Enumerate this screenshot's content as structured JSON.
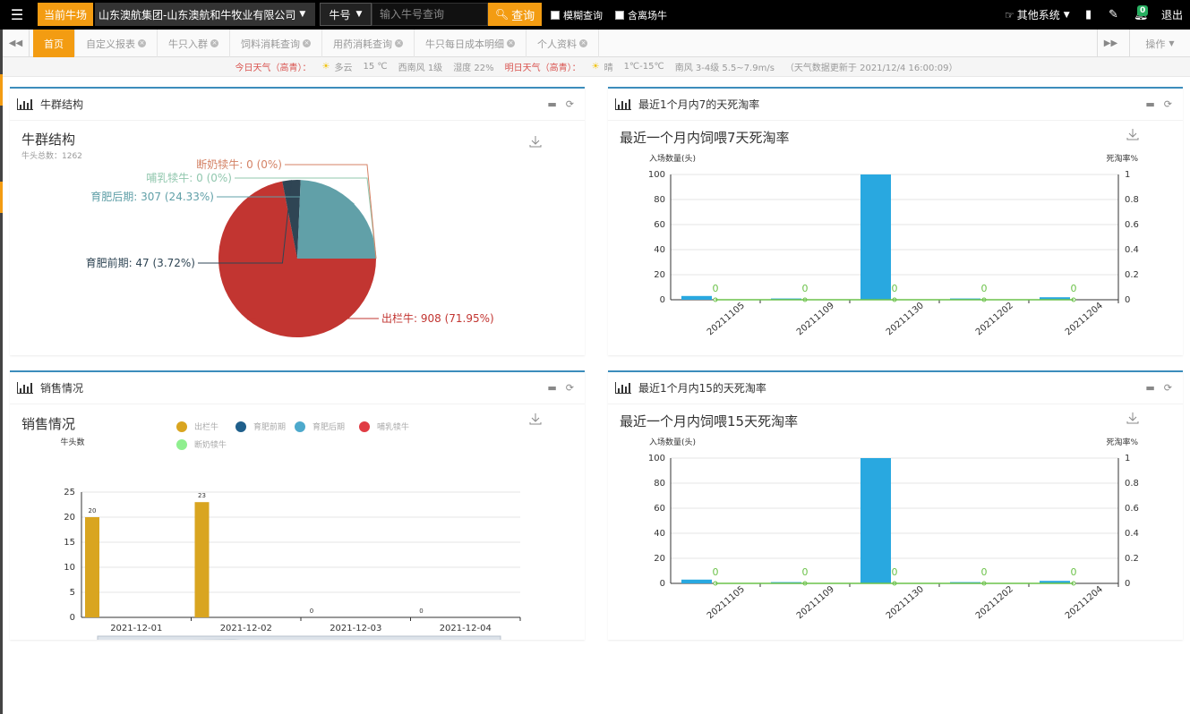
{
  "topbar": {
    "current_farm_label": "当前牛场",
    "farm_name": "山东澳航集团-山东澳航和牛牧业有限公司",
    "cattle_type": "牛号",
    "search_placeholder": "输入牛号查询",
    "query_label": "查询",
    "fuzzy_label": "模糊查询",
    "include_left_label": "含离场牛",
    "other_systems_label": "其他系统",
    "notification_count": "0",
    "logout_label": "退出"
  },
  "tabs": [
    {
      "label": "首页",
      "active": true,
      "closable": false
    },
    {
      "label": "自定义报表",
      "active": false,
      "closable": true
    },
    {
      "label": "牛只入群",
      "active": false,
      "closable": true
    },
    {
      "label": "饲料消耗查询",
      "active": false,
      "closable": true
    },
    {
      "label": "用药消耗查询",
      "active": false,
      "closable": true
    },
    {
      "label": "牛只每日成本明细",
      "active": false,
      "closable": true
    },
    {
      "label": "个人资料",
      "active": false,
      "closable": true
    }
  ],
  "tab_ops_label": "操作",
  "weather": {
    "today_label": "今日天气（高青）：",
    "today_cond": "多云",
    "today_temp": "15 ℃",
    "today_wind": "西南风 1级",
    "today_humidity": "湿度 22%",
    "tomorrow_label": "明日天气（高青）：",
    "tomorrow_cond": "晴",
    "tomorrow_temp": "1℃-15℃",
    "tomorrow_wind": "南风 3-4级 5.5~7.9m/s",
    "updated": "（天气数据更新于 2021/12/4 16:00:09）"
  },
  "panels": {
    "p1": {
      "title": "牛群结构"
    },
    "p2": {
      "title": "最近1个月内7的天死淘率"
    },
    "p3": {
      "title": "销售情况"
    },
    "p4": {
      "title": "最近1个月内15的天死淘率"
    }
  },
  "chart_data": [
    {
      "type": "pie",
      "title": "牛群结构",
      "subtitle": "牛头总数：1262",
      "slices": [
        {
          "name": "出栏牛",
          "value": 908,
          "pct": "71.95%",
          "color": "#c23531"
        },
        {
          "name": "育肥前期",
          "value": 47,
          "pct": "3.72%",
          "color": "#2f4554"
        },
        {
          "name": "育肥后期",
          "value": 307,
          "pct": "24.33%",
          "color": "#61a0a8"
        },
        {
          "name": "哺乳犊牛",
          "value": 0,
          "pct": "0%",
          "color": "#91c7ae"
        },
        {
          "name": "断奶犊牛",
          "value": 0,
          "pct": "0%",
          "color": "#d48265"
        }
      ]
    },
    {
      "type": "bar",
      "title": "最近一个月内饲喂7天死淘率",
      "ylabel": "入场数量(头)",
      "y2label": "死淘率%",
      "categories": [
        "20211105",
        "20211109",
        "20211130",
        "20211202",
        "20211204"
      ],
      "bar_values": [
        3,
        1,
        100,
        1,
        2
      ],
      "line_values": [
        0,
        0,
        0,
        0,
        0
      ],
      "ylim": [
        0,
        100
      ],
      "y2lim": [
        0,
        1
      ],
      "yticks": [
        0,
        20,
        40,
        60,
        80,
        100
      ],
      "y2ticks": [
        0,
        0.2,
        0.4,
        0.6,
        0.8,
        1
      ]
    },
    {
      "type": "bar",
      "title": "销售情况",
      "ylabel": "牛头数",
      "categories": [
        "2021-12-01",
        "2021-12-02",
        "2021-12-03",
        "2021-12-04"
      ],
      "series": [
        {
          "name": "出栏牛",
          "values": [
            20,
            23,
            0,
            0
          ],
          "color": "#d9a520"
        },
        {
          "name": "育肥前期",
          "values": [
            0,
            0,
            0,
            0
          ],
          "color": "#1f5f8b"
        },
        {
          "name": "育肥后期",
          "values": [
            0,
            0,
            0,
            0
          ],
          "color": "#4da9cc"
        },
        {
          "name": "哺乳犊牛",
          "values": [
            0,
            0,
            0,
            0
          ],
          "color": "#e03c44"
        },
        {
          "name": "断奶犊牛",
          "values": [
            0,
            0,
            0,
            0
          ],
          "color": "#8fef8f"
        }
      ],
      "data_labels": [
        "20",
        "23",
        "0",
        "0"
      ],
      "ylim": [
        0,
        25
      ],
      "yticks": [
        0,
        5,
        10,
        15,
        20,
        25
      ]
    },
    {
      "type": "bar",
      "title": "最近一个月内饲喂15天死淘率",
      "ylabel": "入场数量(头)",
      "y2label": "死淘率%",
      "categories": [
        "20211105",
        "20211109",
        "20211130",
        "20211202",
        "20211204"
      ],
      "bar_values": [
        3,
        1,
        100,
        1,
        2
      ],
      "line_values": [
        0,
        0,
        0,
        0,
        0
      ],
      "ylim": [
        0,
        100
      ],
      "y2lim": [
        0,
        1
      ],
      "yticks": [
        0,
        20,
        40,
        60,
        80,
        100
      ],
      "y2ticks": [
        0,
        0.2,
        0.4,
        0.6,
        0.8,
        1
      ]
    }
  ],
  "colors": {
    "accent": "#f39c12",
    "panel_border": "#3c8dbc",
    "bar": "#29a8e0",
    "line": "#6cc24a"
  }
}
